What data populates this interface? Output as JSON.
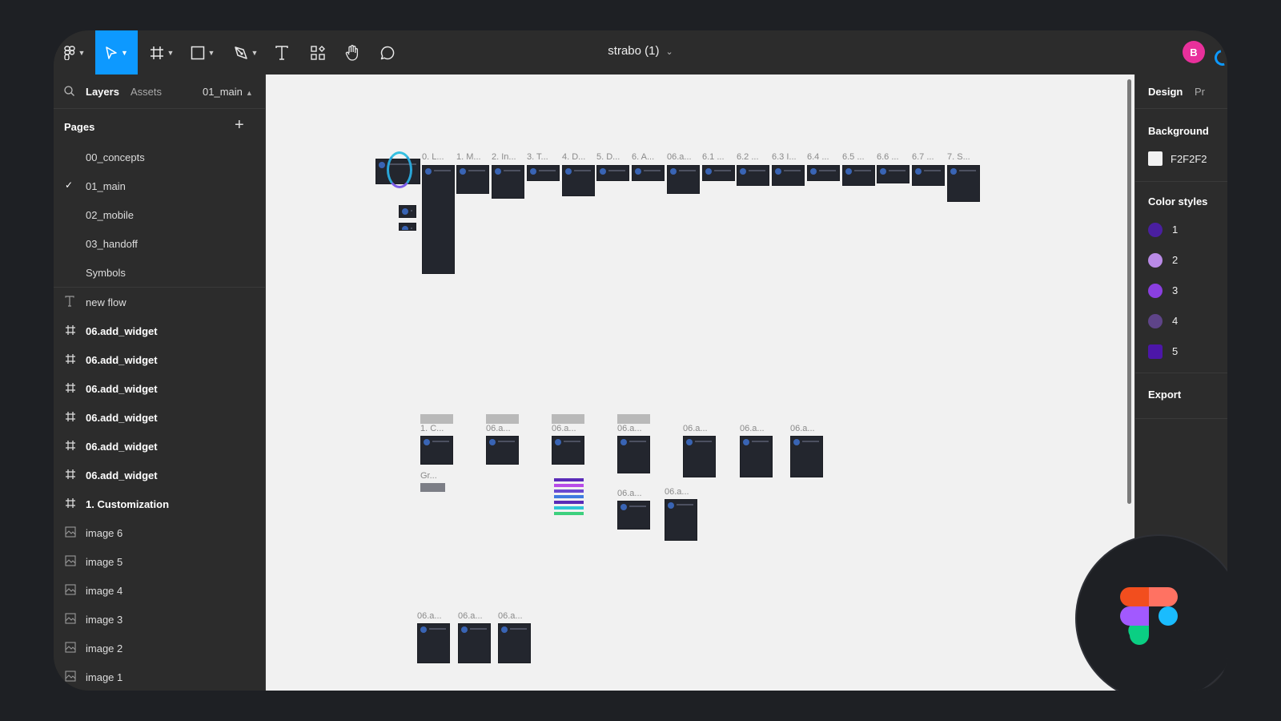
{
  "toolbar": {
    "document_title": "strabo (1)",
    "avatar_initial": "B",
    "tools": [
      "figma-menu-icon",
      "move-tool-icon",
      "frame-tool-icon",
      "shape-tool-icon",
      "pen-tool-icon",
      "text-tool-icon",
      "resources-icon",
      "hand-tool-icon",
      "comment-icon"
    ]
  },
  "left_panel": {
    "tabs": {
      "layers": "Layers",
      "assets": "Assets"
    },
    "current_page": "01_main",
    "pages_title": "Pages",
    "pages": [
      {
        "label": "00_concepts",
        "selected": false
      },
      {
        "label": "01_main",
        "selected": true
      },
      {
        "label": "02_mobile",
        "selected": false
      },
      {
        "label": "03_handoff",
        "selected": false
      },
      {
        "label": "Symbols",
        "selected": false
      }
    ],
    "layers": [
      {
        "label": "new flow",
        "type": "text"
      },
      {
        "label": "06.add_widget",
        "type": "frame"
      },
      {
        "label": "06.add_widget",
        "type": "frame"
      },
      {
        "label": "06.add_widget",
        "type": "frame"
      },
      {
        "label": "06.add_widget",
        "type": "frame"
      },
      {
        "label": "06.add_widget",
        "type": "frame"
      },
      {
        "label": "06.add_widget",
        "type": "frame"
      },
      {
        "label": "1. Customization",
        "type": "frame"
      },
      {
        "label": "image 6",
        "type": "image"
      },
      {
        "label": "image 5",
        "type": "image"
      },
      {
        "label": "image 4",
        "type": "image"
      },
      {
        "label": "image 3",
        "type": "image"
      },
      {
        "label": "image 2",
        "type": "image"
      },
      {
        "label": "image 1",
        "type": "image"
      }
    ]
  },
  "canvas": {
    "background": "#F2F2F2",
    "top_row_labels": [
      "0. L...",
      "1. M...",
      "2. In...",
      "3. T...",
      "4. D...",
      "5. D...",
      "6. A...",
      "06.a...",
      "6.1 ...",
      "6.2 ...",
      "6.3 I...",
      "6.4 ...",
      "6.5 ...",
      "6.6 ...",
      "6.7 ...",
      "7. S..."
    ],
    "mid_row_labels": [
      "1. C...",
      "06.a...",
      "06.a...",
      "06.a...",
      "06.a...",
      "06.a...",
      "06.a..."
    ],
    "group_label": "Gr...",
    "sub_row_labels": [
      "06.a...",
      "06.a..."
    ],
    "bottom_row_labels": [
      "06.a...",
      "06.a...",
      "06.a..."
    ]
  },
  "right_panel": {
    "tabs": {
      "design": "Design",
      "prototype": "Pr"
    },
    "background_title": "Background",
    "background_hex": "F2F2F2",
    "background_color": "#F2F2F2",
    "color_styles_title": "Color styles",
    "color_styles": [
      {
        "label": "1",
        "color": "#4a1fa0"
      },
      {
        "label": "2",
        "color": "#b98ae6"
      },
      {
        "label": "3",
        "color": "#8a3fe0"
      },
      {
        "label": "4",
        "color": "#5e4488"
      },
      {
        "label": "5",
        "color": "#4c16a8"
      }
    ],
    "export_title": "Export"
  },
  "logo": {
    "name": "figma-logo",
    "colors": [
      "#f24e1e",
      "#ff7262",
      "#a259ff",
      "#1abcfe",
      "#0acf83"
    ]
  }
}
